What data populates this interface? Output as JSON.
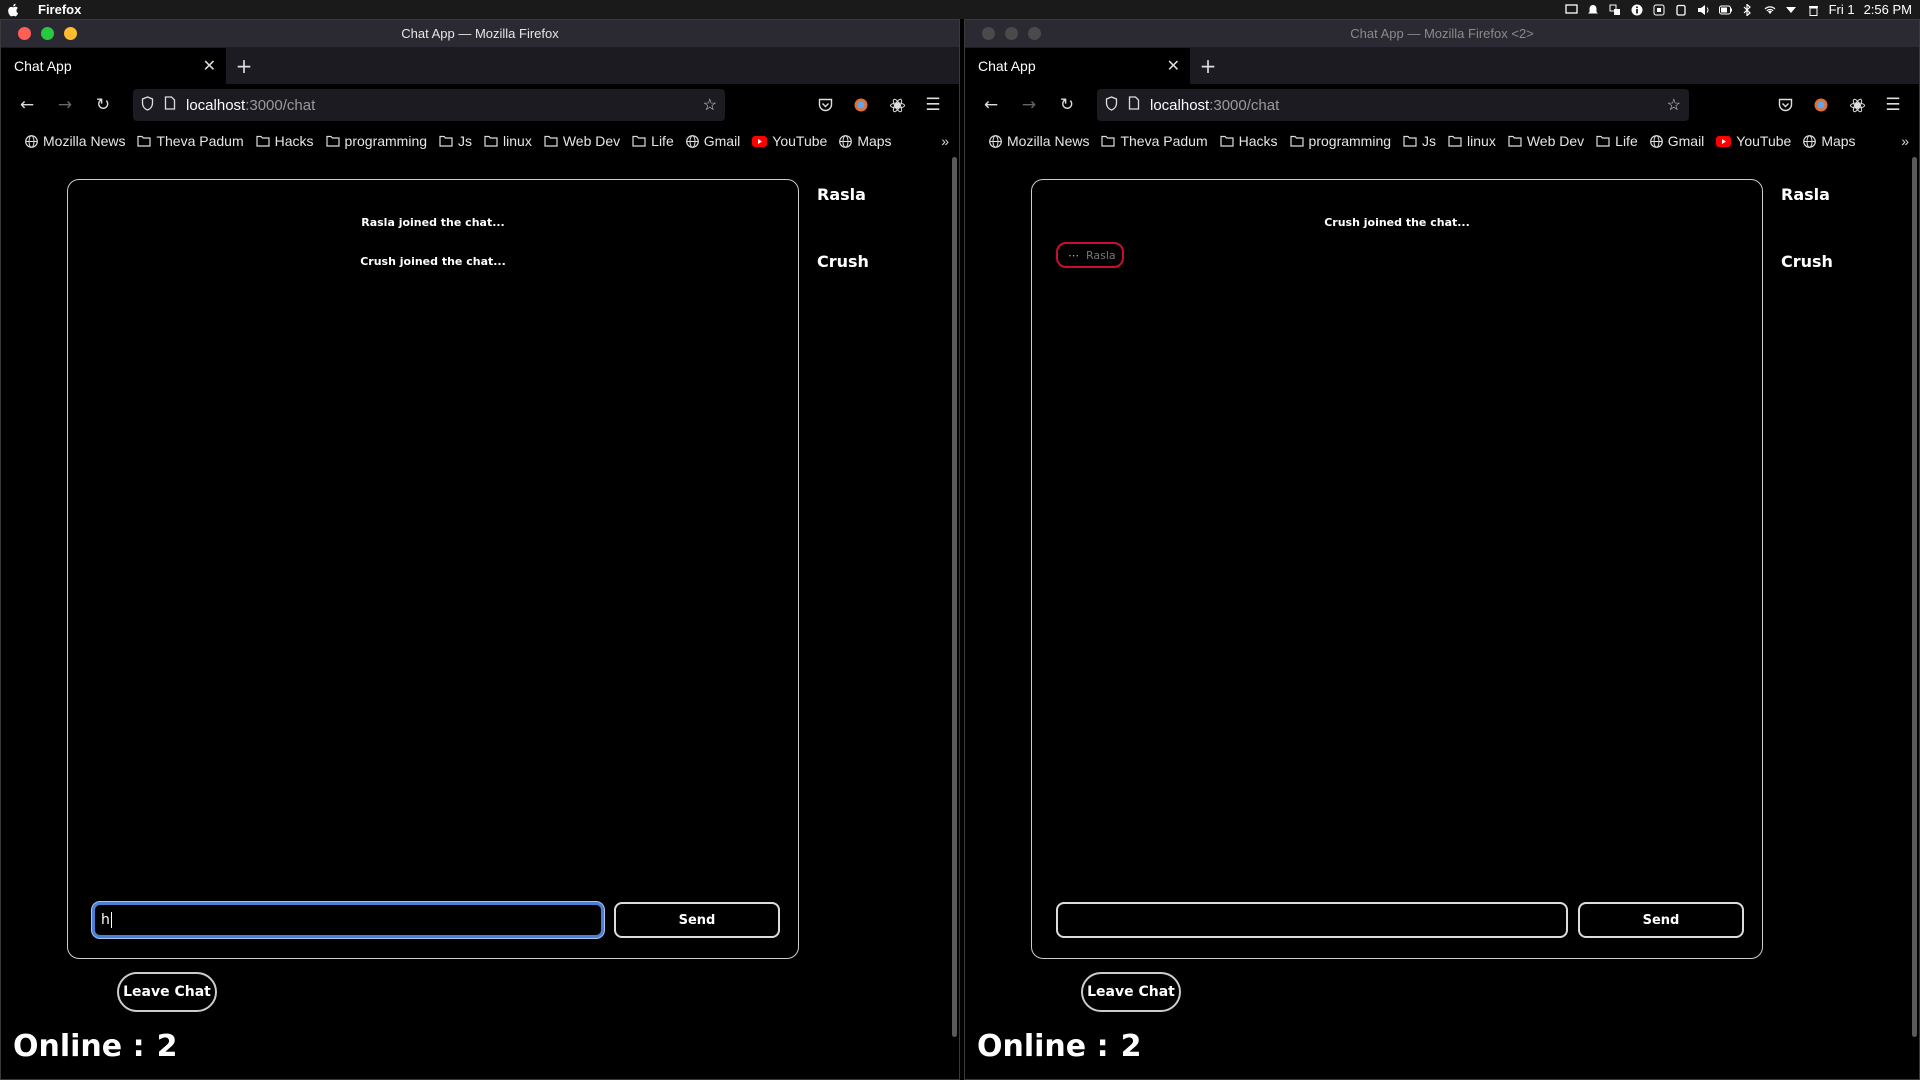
{
  "menubar": {
    "app_name": "Firefox",
    "date": "Fri 1",
    "time": "2:56 PM"
  },
  "colors": {
    "traffic_red": "#ff5f57",
    "traffic_green": "#28c840",
    "traffic_yellow": "#febc2e",
    "inactive_light": "#4a4a4a",
    "typing_border": "#c8102e",
    "focus_ring": "#4a7fd6"
  },
  "windows": [
    {
      "title": "Chat App — Mozilla Firefox",
      "tab_title": "Chat App",
      "url_host": "localhost",
      "url_path": ":3000/chat",
      "bookmarks": [
        "Mozilla News",
        "Theva Padum",
        "Hacks",
        "programming",
        "Js",
        "linux",
        "Web Dev",
        "Life",
        "Gmail",
        "YouTube",
        "Maps"
      ],
      "messages": [
        "Rasla joined the chat...",
        "Crush joined the chat..."
      ],
      "typing": null,
      "input_value": "h",
      "send_label": "Send",
      "users": [
        "Rasla",
        "Crush"
      ],
      "leave_label": "Leave Chat",
      "online_label": "Online :",
      "online_count": "2"
    },
    {
      "title": "Chat App — Mozilla Firefox <2>",
      "tab_title": "Chat App",
      "url_host": "localhost",
      "url_path": ":3000/chat",
      "bookmarks": [
        "Mozilla News",
        "Theva Padum",
        "Hacks",
        "programming",
        "Js",
        "linux",
        "Web Dev",
        "Life",
        "Gmail",
        "YouTube",
        "Maps"
      ],
      "messages": [
        "Crush joined the chat..."
      ],
      "typing": "Rasla",
      "input_value": "",
      "send_label": "Send",
      "users": [
        "Rasla",
        "Crush"
      ],
      "leave_label": "Leave Chat",
      "online_label": "Online :",
      "online_count": "2"
    }
  ]
}
